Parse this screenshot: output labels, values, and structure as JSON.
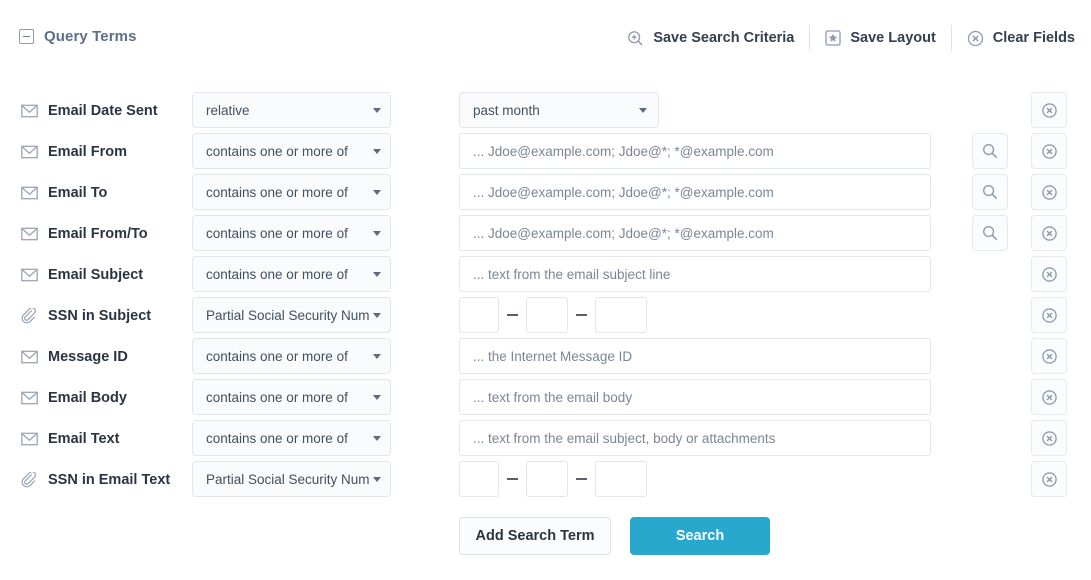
{
  "panel": {
    "title": "Query Terms",
    "collapse_icon": "minus-box-icon"
  },
  "toolbar": {
    "actions": [
      {
        "label": "Save Search Criteria",
        "icon": "magnifier-plus-icon"
      },
      {
        "label": "Save Layout",
        "icon": "star-box-icon"
      },
      {
        "label": "Clear Fields",
        "icon": "circle-x-icon"
      }
    ]
  },
  "colors": {
    "accent": "#28a8cd",
    "panel_title": "#5f6f88",
    "label": "#2b3442",
    "placeholder": "#7b8694",
    "border": "#e3e6ea"
  },
  "rows": [
    {
      "label": "Email Date Sent",
      "icon": "envelope-icon",
      "operator": "relative",
      "value_type": "select",
      "value": "past month",
      "has_lookup": false,
      "has_remove": true
    },
    {
      "label": "Email From",
      "icon": "envelope-icon",
      "operator": "contains one or more of",
      "value_type": "text",
      "placeholder": "... Jdoe@example.com; Jdoe@*; *@example.com",
      "value": "",
      "has_lookup": true,
      "has_remove": true
    },
    {
      "label": "Email To",
      "icon": "envelope-icon",
      "operator": "contains one or more of",
      "value_type": "text",
      "placeholder": "... Jdoe@example.com; Jdoe@*; *@example.com",
      "value": "",
      "has_lookup": true,
      "has_remove": true
    },
    {
      "label": "Email From/To",
      "icon": "envelope-icon",
      "operator": "contains one or more of",
      "value_type": "text",
      "placeholder": "... Jdoe@example.com; Jdoe@*; *@example.com",
      "value": "",
      "has_lookup": true,
      "has_remove": true
    },
    {
      "label": "Email Subject",
      "icon": "envelope-icon",
      "operator": "contains one or more of",
      "value_type": "text",
      "placeholder": "... text from the email subject line",
      "value": "",
      "has_lookup": false,
      "has_remove": true
    },
    {
      "label": "SSN in Subject",
      "icon": "paperclip-icon",
      "operator": "Partial Social Security Numbe",
      "value_type": "ssn",
      "ssn": {
        "part1": "",
        "part2": "",
        "part3": "",
        "separator": "—"
      },
      "has_lookup": false,
      "has_remove": true
    },
    {
      "label": "Message ID",
      "icon": "envelope-icon",
      "operator": "contains one or more of",
      "value_type": "text",
      "placeholder": "... the Internet Message ID",
      "value": "",
      "has_lookup": false,
      "has_remove": true
    },
    {
      "label": "Email Body",
      "icon": "envelope-icon",
      "operator": "contains one or more of",
      "value_type": "text",
      "placeholder": "... text from the email body",
      "value": "",
      "has_lookup": false,
      "has_remove": true
    },
    {
      "label": "Email Text",
      "icon": "envelope-icon",
      "operator": "contains one or more of",
      "value_type": "text",
      "placeholder": "... text from the email subject, body or attachments",
      "value": "",
      "has_lookup": false,
      "has_remove": true
    },
    {
      "label": "SSN in Email Text",
      "icon": "paperclip-icon",
      "operator": "Partial Social Security Numbe",
      "value_type": "ssn",
      "ssn": {
        "part1": "",
        "part2": "",
        "part3": "",
        "separator": "—"
      },
      "has_lookup": false,
      "has_remove": true
    }
  ],
  "footer": {
    "add_term_label": "Add Search Term",
    "search_label": "Search"
  }
}
